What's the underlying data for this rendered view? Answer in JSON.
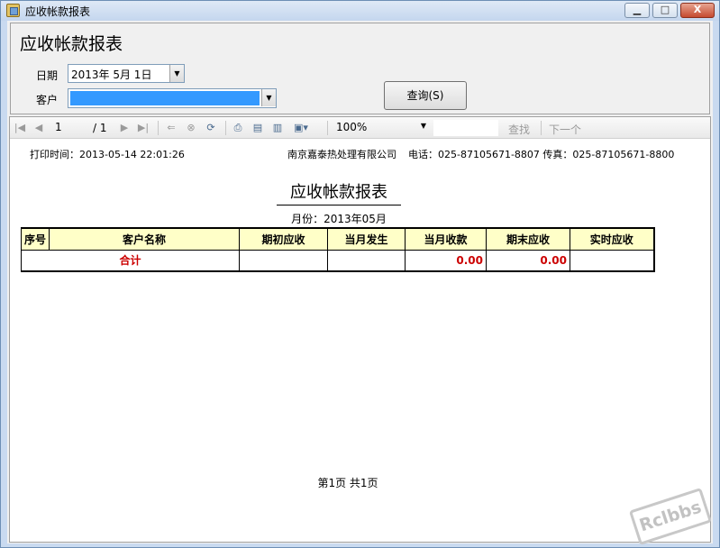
{
  "window": {
    "title": "应收帐款报表",
    "minimize_glyph": "▁",
    "maximize_glyph": "□",
    "close_glyph": "X"
  },
  "form": {
    "heading": "应收帐款报表",
    "date_label": "日期",
    "date_value": "2013年  5月  1日",
    "customer_label": "客户",
    "customer_value": "",
    "query_button": "查询(S)"
  },
  "toolbar": {
    "page_current": "1",
    "page_total": "/ 1",
    "zoom": "100%",
    "find_label": "查找",
    "next_label": "下一个",
    "icons": [
      "first-page-icon",
      "prev-page-icon",
      "next-page-icon",
      "last-page-icon",
      "back-icon",
      "stop-icon",
      "refresh-icon",
      "print-icon",
      "page-setup-icon",
      "print-layout-icon",
      "export-icon"
    ]
  },
  "report": {
    "print_time": "打印时间：2013-05-14 22:01:26",
    "company": "南京嘉泰热处理有限公司",
    "contact": "电话：025-87105671-8807 传真：025-87105671-8800",
    "title": "应收帐款报表",
    "month": "月份：2013年05月",
    "columns": [
      "序号",
      "客户名称",
      "期初应收",
      "当月发生",
      "当月收款",
      "期末应收",
      "实时应收"
    ],
    "total_row": {
      "label": "合计",
      "opening": "",
      "current": "",
      "received": "0.00",
      "closing": "0.00",
      "realtime": ""
    },
    "footer": "第1页   共1页"
  },
  "watermark": "Rclbbs"
}
